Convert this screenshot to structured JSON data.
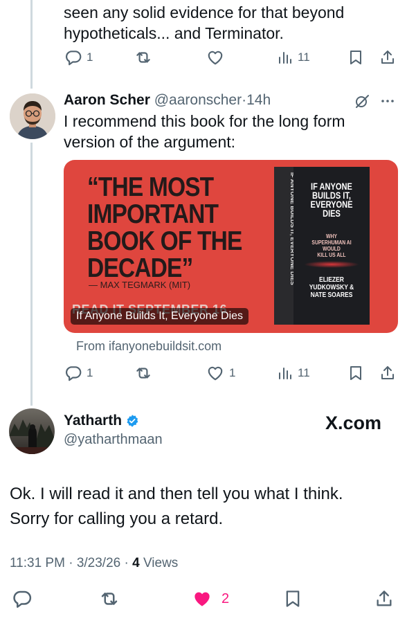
{
  "prev_tweet": {
    "text_line1": "seen any solid evidence for that beyond",
    "text_line2": "hypotheticals... and Terminator.",
    "reply_count": "1",
    "retweet_count": "",
    "like_count": "",
    "view_count": "11"
  },
  "reply_tweet": {
    "name": "Aaron Scher",
    "handle": "@aaronscher",
    "separator": "·",
    "time": "14h",
    "text_line1": "I recommend this book for the long form",
    "text_line2": "version of the argument:",
    "card": {
      "quote_line1": "“THE MOST",
      "quote_line2": "IMPORTANT",
      "quote_line3": "BOOK OF THE",
      "quote_line4": "DECADE”",
      "quote_attr": "— MAX TEGMARK (MIT)",
      "read_text": "READ IT SEPTEMBER 16",
      "book_title1": "IF ANYONE",
      "book_title2": "BUILDS IT,",
      "book_title3": "EVERYONE",
      "book_title4": "DIES",
      "book_sub1": "WHY",
      "book_sub2": "SUPERHUMAN AI",
      "book_sub3": "WOULD",
      "book_sub4": "KILL US ALL",
      "book_authors1": "ELIEZER",
      "book_authors2": "YUDKOWSKY &",
      "book_authors3": "NATE SOARES",
      "spine_text": "IF ANYONE BUILDS IT, EVERYONE DIES",
      "caption": "If Anyone Builds It, Everyone Dies",
      "source": "From ifanyonebuildsit.com"
    },
    "reply_count": "1",
    "retweet_count": "",
    "like_count": "1",
    "view_count": "11"
  },
  "main_tweet": {
    "name": "Yatharth",
    "handle": "@yatharthmaan",
    "brand": "X.com",
    "text_line1": "Ok. I will read it and then tell you what I think.",
    "text_line2": "Sorry for calling you a retard.",
    "time": "11:31 PM",
    "sep1": "·",
    "date": "3/23/26",
    "sep2": "·",
    "views_count": "4",
    "views_label": "Views",
    "like_count": "2"
  },
  "colors": {
    "accent": "#1d9bf0",
    "like_pink": "#f91880",
    "card_red": "#e0453d",
    "text_gray": "#536471"
  },
  "icons": [
    "reply-icon",
    "retweet-icon",
    "like-icon",
    "views-icon",
    "bookmark-icon",
    "share-icon",
    "grok-icon",
    "more-icon",
    "verified-icon"
  ]
}
